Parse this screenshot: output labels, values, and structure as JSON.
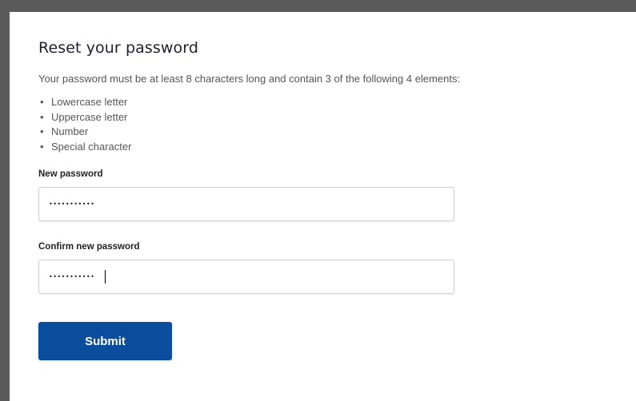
{
  "form": {
    "title": "Reset your password",
    "intro": "Your password must be at least 8 characters long and contain 3 of the following 4 elements:",
    "rules": [
      "Lowercase letter",
      "Uppercase letter",
      "Number",
      "Special character"
    ],
    "new_password": {
      "label": "New password",
      "value": "•••••••••••"
    },
    "confirm_password": {
      "label": "Confirm new password",
      "value": "•••••••••••"
    },
    "submit_label": "Submit"
  },
  "colors": {
    "submit_background": "#0a4d9c",
    "frame": "#5a5a5a"
  }
}
